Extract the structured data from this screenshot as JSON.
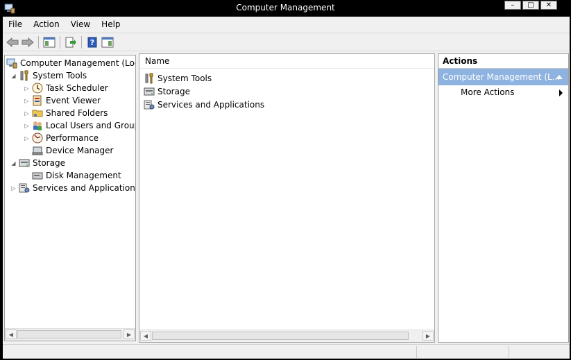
{
  "window": {
    "title": "Computer Management",
    "minimize_label": "–",
    "maximize_label": "□",
    "close_label": "✕"
  },
  "menu": [
    "File",
    "Action",
    "View",
    "Help"
  ],
  "toolbar": {
    "buttons": [
      "back-icon",
      "forward-icon",
      "show-hide-console-tree-icon",
      "export-list-icon",
      "help-icon",
      "show-hide-action-pane-icon"
    ]
  },
  "tree": {
    "root": "Computer Management (Local",
    "items": [
      {
        "label": "System Tools",
        "icon": "tools-icon",
        "expander": "◢"
      },
      {
        "label": "Task Scheduler",
        "icon": "clock-icon",
        "expander": "▷"
      },
      {
        "label": "Event Viewer",
        "icon": "event-log-icon",
        "expander": "▷"
      },
      {
        "label": "Shared Folders",
        "icon": "shared-folder-icon",
        "expander": "▷"
      },
      {
        "label": "Local Users and Groups",
        "icon": "users-icon",
        "expander": "▷"
      },
      {
        "label": "Performance",
        "icon": "performance-icon",
        "expander": "▷"
      },
      {
        "label": "Device Manager",
        "icon": "device-manager-icon",
        "expander": ""
      },
      {
        "label": "Storage",
        "icon": "storage-icon",
        "expander": "◢"
      },
      {
        "label": "Disk Management",
        "icon": "disk-icon",
        "expander": ""
      },
      {
        "label": "Services and Applications",
        "icon": "services-icon",
        "expander": "▷"
      }
    ]
  },
  "list": {
    "column_name": "Name",
    "rows": [
      {
        "label": "System Tools",
        "icon": "tools-icon"
      },
      {
        "label": "Storage",
        "icon": "storage-icon"
      },
      {
        "label": "Services and Applications",
        "icon": "services-icon"
      }
    ]
  },
  "actions": {
    "title": "Actions",
    "section": "Computer Management (L...",
    "item": "More Actions"
  },
  "scroll": {
    "left": "◀",
    "right": "▶"
  },
  "colors": {
    "selection": "#8fb3e0",
    "titlebar": "#000000",
    "chrome": "#f0f0f0"
  }
}
